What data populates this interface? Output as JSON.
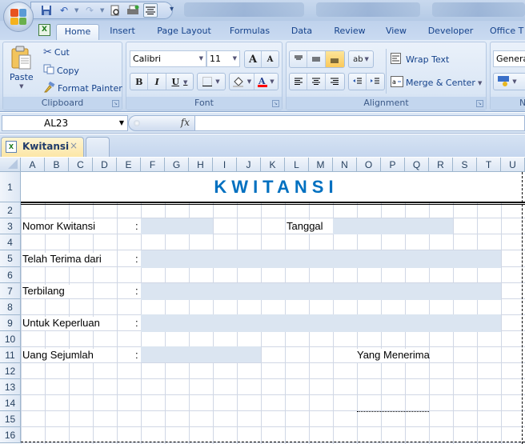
{
  "title_bar": {
    "quick_access": [
      "save-icon",
      "undo-icon",
      "redo-icon",
      "print-preview-icon",
      "quick-print-icon",
      "align-icon"
    ],
    "customize_label": "▾"
  },
  "tabs": [
    {
      "label": "Home",
      "active": true
    },
    {
      "label": "Insert"
    },
    {
      "label": "Page Layout"
    },
    {
      "label": "Formulas"
    },
    {
      "label": "Data"
    },
    {
      "label": "Review"
    },
    {
      "label": "View"
    },
    {
      "label": "Developer"
    },
    {
      "label": "Office T"
    }
  ],
  "ribbon": {
    "clipboard": {
      "label": "Clipboard",
      "paste": "Paste",
      "cut": "Cut",
      "copy": "Copy",
      "format_painter": "Format Painter"
    },
    "font": {
      "label": "Font",
      "font_name": "Calibri",
      "font_size": "11",
      "bold": "B",
      "italic": "I",
      "underline": "U",
      "grow": "A",
      "shrink": "A",
      "font_color": "#ff0000",
      "fill_color": "#c0c0c0"
    },
    "alignment": {
      "label": "Alignment",
      "wrap_text": "Wrap Text",
      "merge_center": "Merge & Center"
    },
    "number": {
      "label": "N",
      "format": "General"
    }
  },
  "formula_bar": {
    "name_box": "AL23",
    "fx": "fx",
    "formula": ""
  },
  "doc_tabs": [
    {
      "label": "Kwitansi",
      "close": "×"
    }
  ],
  "columns": [
    "A",
    "B",
    "C",
    "D",
    "E",
    "F",
    "G",
    "H",
    "I",
    "J",
    "K",
    "L",
    "M",
    "N",
    "O",
    "P",
    "Q",
    "R",
    "S",
    "T",
    "U"
  ],
  "rows": [
    "1",
    "2",
    "3",
    "4",
    "5",
    "6",
    "7",
    "8",
    "9",
    "10",
    "11",
    "12",
    "13",
    "14",
    "15",
    "16"
  ],
  "sheet": {
    "title": "KWITANSI",
    "title_color": "#0070c0",
    "input_fill": "#dbe5f1",
    "labels": {
      "nomor": "Nomor Kwitansi",
      "tanggal": "Tanggal",
      "terima": "Telah Terima dari",
      "terbilang": "Terbilang",
      "keperluan": "Untuk Keperluan",
      "uang": "Uang Sejumlah",
      "penerima": "Yang Menerima"
    },
    "colon": ":"
  }
}
